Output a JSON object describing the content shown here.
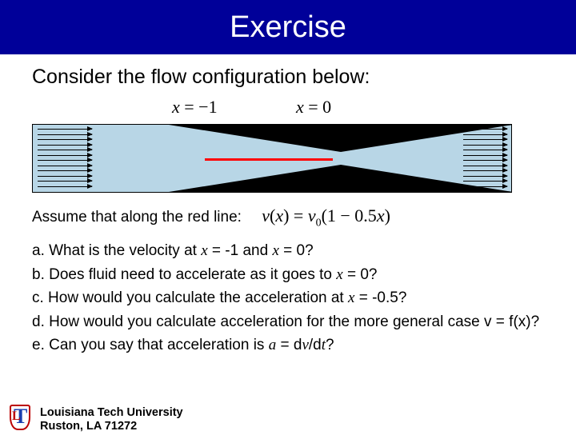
{
  "title": "Exercise",
  "prompt": "Consider the flow configuration below:",
  "labels": {
    "left_var": "x",
    "left_eq": " = −1",
    "right_var": "x",
    "right_eq": " = 0"
  },
  "assume": {
    "prefix": "Assume that along the red line:",
    "v": "v",
    "open": "(",
    "x": "x",
    "close": ") = ",
    "v0": "v",
    "sub0": "0",
    "factor_open": "(1 − 0.5",
    "x2": "x",
    "factor_close": ")"
  },
  "questions": {
    "a_pre": "a. What is the velocity at ",
    "a_x1": "x",
    "a_mid": " = -1 and ",
    "a_x2": "x",
    "a_post": " = 0?",
    "b_pre": "b. Does fluid need to accelerate as it goes to ",
    "b_x": "x",
    "b_post": " = 0?",
    "c_pre": "c. How would you calculate the acceleration at ",
    "c_x": "x",
    "c_post": " = -0.5?",
    "d": "d. How would you calculate acceleration for the more general case v = f(x)?",
    "e_pre": "e. Can you say that acceleration is ",
    "e_a": "a",
    "e_mid": " = d",
    "e_v": "v",
    "e_mid2": "/d",
    "e_t": "t",
    "e_post": "?"
  },
  "footer": {
    "line1": "Louisiana Tech University",
    "line2": "Ruston, LA 71272"
  }
}
